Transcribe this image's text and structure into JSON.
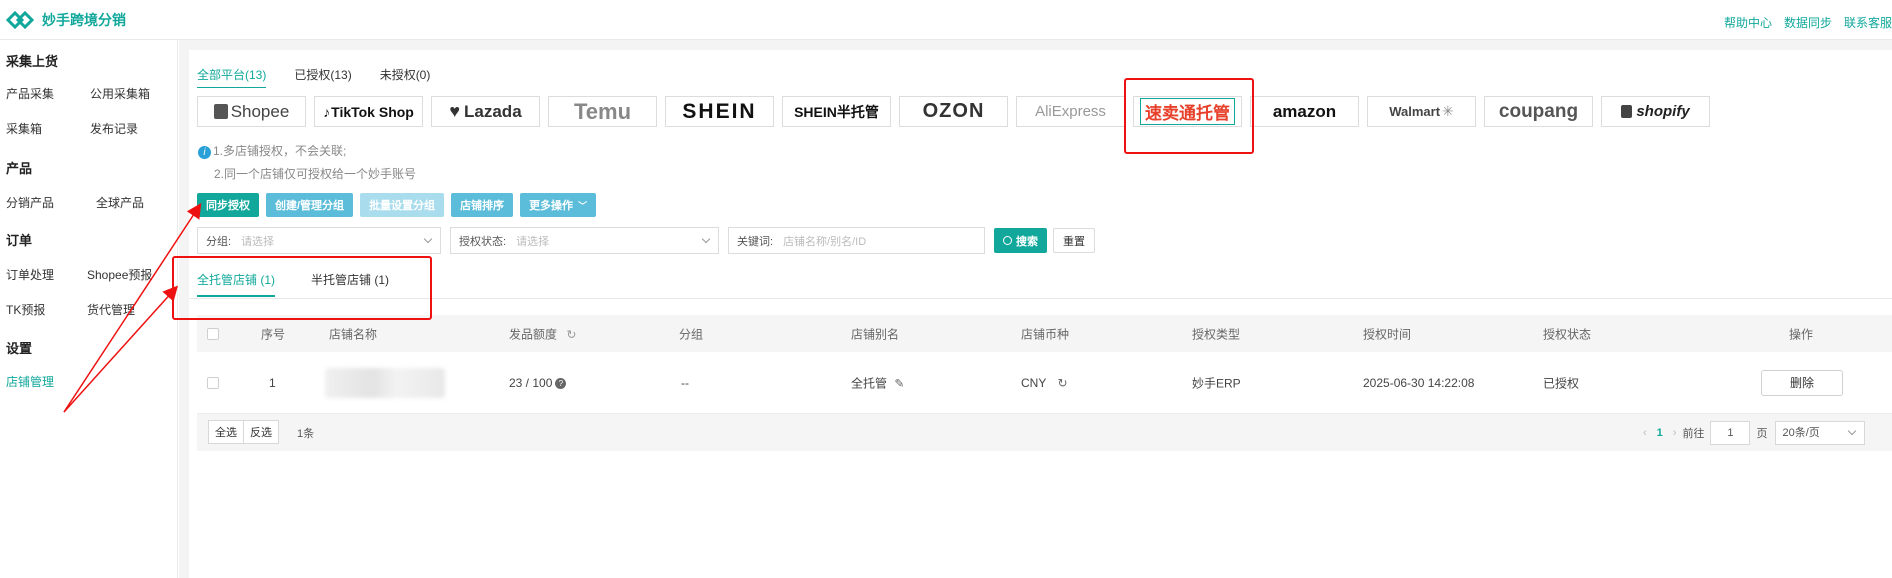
{
  "header": {
    "brand": "妙手跨境分销",
    "links": [
      "帮助中心",
      "数据同步",
      "联系客服"
    ]
  },
  "sidebar": {
    "sections": [
      {
        "title": "采集上货",
        "items": [
          "产品采集",
          "公用采集箱",
          "采集箱",
          "发布记录"
        ]
      },
      {
        "title": "产品",
        "items": [
          "分销产品",
          "全球产品"
        ]
      },
      {
        "title": "订单",
        "items": [
          "订单处理",
          "Shopee预报",
          "TK预报",
          "货代管理"
        ]
      },
      {
        "title": "设置",
        "items": [
          "店铺管理"
        ]
      }
    ],
    "active": "店铺管理"
  },
  "platform_tabs": [
    "全部平台(13)",
    "已授权(13)",
    "未授权(0)"
  ],
  "platforms": [
    {
      "name": "Shopee",
      "color": "#444444"
    },
    {
      "name": "TikTok Shop",
      "color": "#111111"
    },
    {
      "name": "Lazada",
      "color": "#333333"
    },
    {
      "name": "Temu",
      "color": "#888888"
    },
    {
      "name": "SHEIN",
      "color": "#111111"
    },
    {
      "name": "SHEIN半托管",
      "color": "#111111"
    },
    {
      "name": "OZON",
      "color": "#333333"
    },
    {
      "name": "AliExpress",
      "color": "#999999"
    },
    {
      "name": "速卖通托管",
      "color": "#e8412b"
    },
    {
      "name": "amazon",
      "color": "#111111"
    },
    {
      "name": "Walmart",
      "color": "#444444"
    },
    {
      "name": "coupang",
      "color": "#555555"
    },
    {
      "name": "shopify",
      "color": "#222222"
    }
  ],
  "notes": [
    "1.多店铺授权，不会关联;",
    "2.同一个店铺仅可授权给一个妙手账号"
  ],
  "actions": {
    "sync": "同步授权",
    "group": "创建/管理分组",
    "batch_group": "批量设置分组",
    "sort": "店铺排序",
    "more": "更多操作"
  },
  "filters": {
    "group_label": "分组:",
    "group_placeholder": "请选择",
    "status_label": "授权状态:",
    "status_placeholder": "请选择",
    "keyword_label": "关键词:",
    "keyword_placeholder": "店铺名称/别名/ID",
    "search": "搜索",
    "reset": "重置"
  },
  "subtabs": [
    "全托管店铺 (1)",
    "半托管店铺 (1)"
  ],
  "table": {
    "columns": [
      "序号",
      "店铺名称",
      "发品额度",
      "分组",
      "店铺别名",
      "店铺币种",
      "授权类型",
      "授权时间",
      "授权状态",
      "操作"
    ],
    "rows": [
      {
        "index": "1",
        "quota": "23 / 100",
        "group": "--",
        "alias": "全托管",
        "currency": "CNY",
        "auth_type": "妙手ERP",
        "auth_time": "2025-06-30 14:22:08",
        "status": "已授权",
        "action": "删除"
      }
    ]
  },
  "footer": {
    "select_all": "全选",
    "invert": "反选",
    "count": "1条",
    "current_page": "1",
    "goto_label": "前往",
    "goto_value": "1",
    "page_unit": "页",
    "page_size": "20条/页"
  }
}
